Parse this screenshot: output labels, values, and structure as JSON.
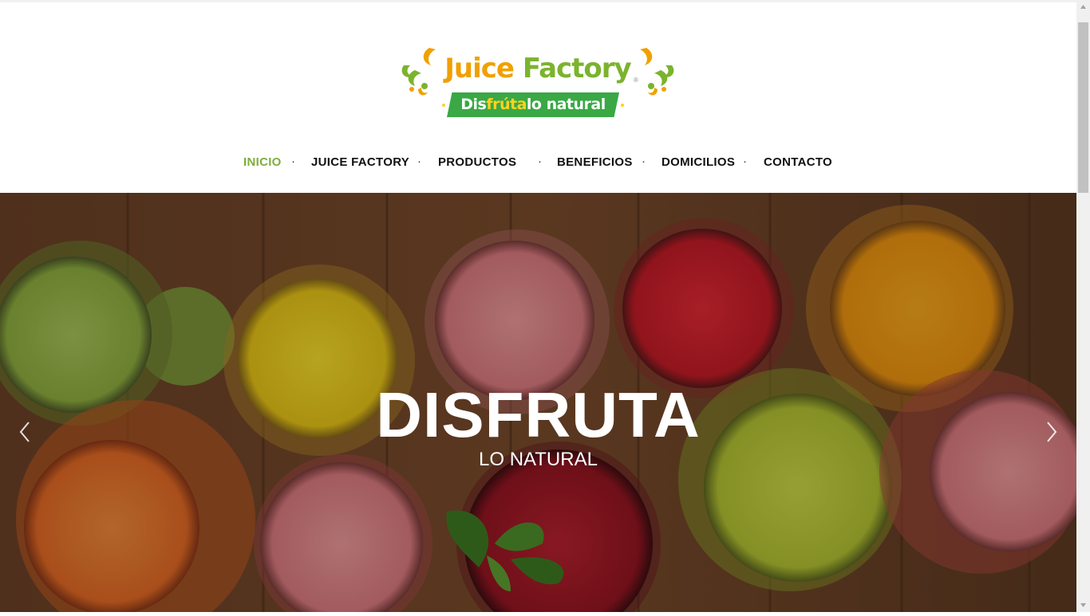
{
  "logo": {
    "word1": "Juice",
    "word2": "Factory",
    "registered": "®",
    "tagline_part1": "Dis",
    "tagline_highlight": "frúta",
    "tagline_part2": "lo natural"
  },
  "nav": {
    "items": [
      {
        "label": "INICIO",
        "active": true
      },
      {
        "label": "JUICE FACTORY"
      },
      {
        "label": "PRODUCTOS"
      },
      {
        "label": "BENEFICIOS"
      },
      {
        "label": "DOMICILIOS"
      },
      {
        "label": "CONTACTO"
      }
    ],
    "separator": "·"
  },
  "hero": {
    "title": "DISFRUTA",
    "subtitle": "LO NATURAL",
    "prev_icon": "chevron-left-icon",
    "next_icon": "chevron-right-icon"
  },
  "colors": {
    "accent_green": "#7cae3b",
    "logo_orange": "#f0a000",
    "logo_green": "#7bb32e",
    "banner_green": "#39a845"
  }
}
